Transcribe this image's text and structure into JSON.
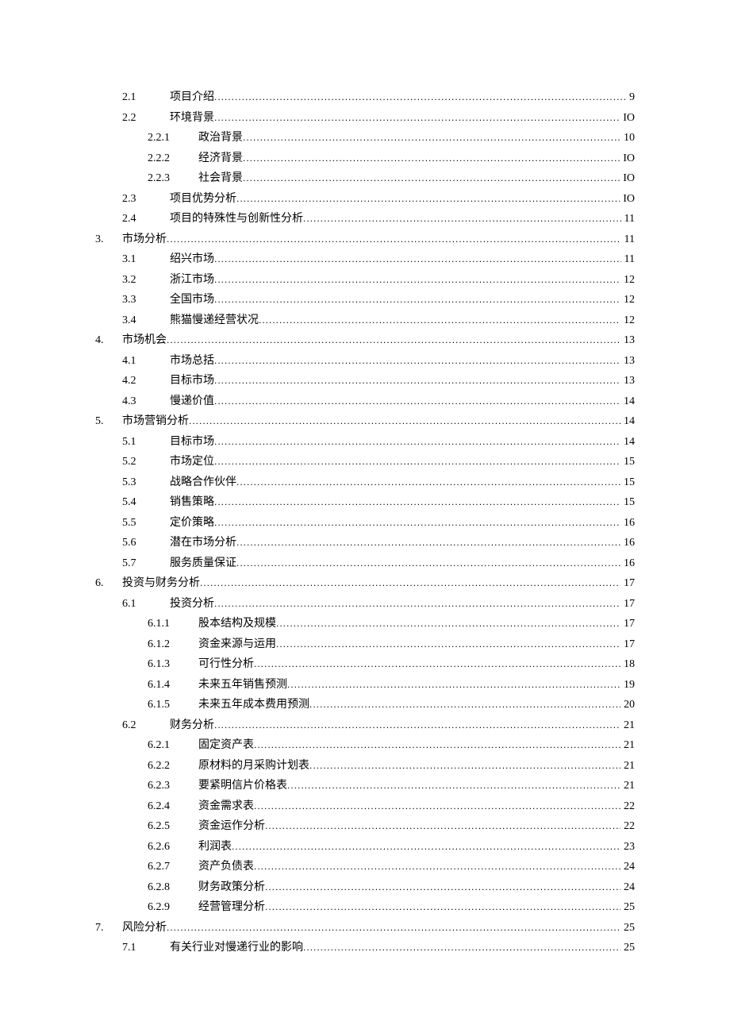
{
  "toc": [
    {
      "level": 2,
      "num": "2.1",
      "title": "项目介绍",
      "page": "9"
    },
    {
      "level": 2,
      "num": "2.2",
      "title": "环境背景",
      "page": "IO"
    },
    {
      "level": 3,
      "num": "2.2.1",
      "title": "政治背景",
      "page": "10"
    },
    {
      "level": 3,
      "num": "2.2.2",
      "title": "经济背景",
      "page": "IO"
    },
    {
      "level": 3,
      "num": "2.2.3",
      "title": "社会背景",
      "page": "IO"
    },
    {
      "level": 2,
      "num": "2.3",
      "title": "项目优势分析",
      "page": "IO"
    },
    {
      "level": 2,
      "num": "2.4",
      "title": "项目的特殊性与创新性分析",
      "page": "11"
    },
    {
      "level": 1,
      "num": "3.",
      "title": "市场分析",
      "page": "11"
    },
    {
      "level": 2,
      "num": "3.1",
      "title": "绍兴市场",
      "page": "11"
    },
    {
      "level": 2,
      "num": "3.2",
      "title": "浙江市场",
      "page": "12"
    },
    {
      "level": 2,
      "num": "3.3",
      "title": "全国市场",
      "page": "12"
    },
    {
      "level": 2,
      "num": "3.4",
      "title": "熊猫慢递经营状况",
      "page": "12"
    },
    {
      "level": 1,
      "num": "4.",
      "title": "市场机会",
      "page": "13"
    },
    {
      "level": 2,
      "num": "4.1",
      "title": "市场总括",
      "page": "13"
    },
    {
      "level": 2,
      "num": "4.2",
      "title": "目标市场",
      "page": "13"
    },
    {
      "level": 2,
      "num": "4.3",
      "title": "慢递价值",
      "page": "14"
    },
    {
      "level": 1,
      "num": "5.",
      "title": "市场营销分析",
      "page": "14"
    },
    {
      "level": 2,
      "num": "5.1",
      "title": "目标市场",
      "page": "14"
    },
    {
      "level": 2,
      "num": "5.2",
      "title": "市场定位",
      "page": "15"
    },
    {
      "level": 2,
      "num": "5.3",
      "title": "战略合作伙伴",
      "page": "15"
    },
    {
      "level": 2,
      "num": "5.4",
      "title": "销售策略",
      "page": "15"
    },
    {
      "level": 2,
      "num": "5.5",
      "title": "定价策略",
      "page": "16"
    },
    {
      "level": 2,
      "num": "5.6",
      "title": "潜在市场分析",
      "page": "16"
    },
    {
      "level": 2,
      "num": "5.7",
      "title": "服务质量保证",
      "page": "16"
    },
    {
      "level": 1,
      "num": "6.",
      "title": "投资与财务分析",
      "page": "17"
    },
    {
      "level": 2,
      "num": "6.1",
      "title": "投资分析",
      "page": "17"
    },
    {
      "level": 3,
      "num": "6.1.1",
      "title": "股本结构及规模",
      "page": "17"
    },
    {
      "level": 3,
      "num": "6.1.2",
      "title": "资金来源与运用",
      "page": "17"
    },
    {
      "level": 3,
      "num": "6.1.3",
      "title": "可行性分析",
      "page": "18"
    },
    {
      "level": 3,
      "num": "6.1.4",
      "title": "未来五年销售预测",
      "page": "19"
    },
    {
      "level": 3,
      "num": "6.1.5",
      "title": "未来五年成本费用预测",
      "page": "20"
    },
    {
      "level": 2,
      "num": "6.2",
      "title": "财务分析",
      "page": "21"
    },
    {
      "level": 3,
      "num": "6.2.1",
      "title": "固定资产表",
      "page": "21"
    },
    {
      "level": 3,
      "num": "6.2.2",
      "title": "原材料的月采购计划表",
      "page": "21"
    },
    {
      "level": 3,
      "num": "6.2.3",
      "title": "要紧明信片价格表",
      "page": "21"
    },
    {
      "level": 3,
      "num": "6.2.4",
      "title": "资金需求表",
      "page": "22"
    },
    {
      "level": 3,
      "num": "6.2.5",
      "title": "资金运作分析",
      "page": "22"
    },
    {
      "level": 3,
      "num": "6.2.6",
      "title": "利润表",
      "page": "23"
    },
    {
      "level": 3,
      "num": "6.2.7",
      "title": "资产负债表",
      "page": "24"
    },
    {
      "level": 3,
      "num": "6.2.8",
      "title": "财务政策分析",
      "page": "24"
    },
    {
      "level": 3,
      "num": "6.2.9",
      "title": "经营管理分析",
      "page": "25"
    },
    {
      "level": 1,
      "num": "7.",
      "title": "风险分析",
      "page": "25"
    },
    {
      "level": 2,
      "num": "7.1",
      "title": "有关行业对慢递行业的影响",
      "page": "25"
    }
  ]
}
